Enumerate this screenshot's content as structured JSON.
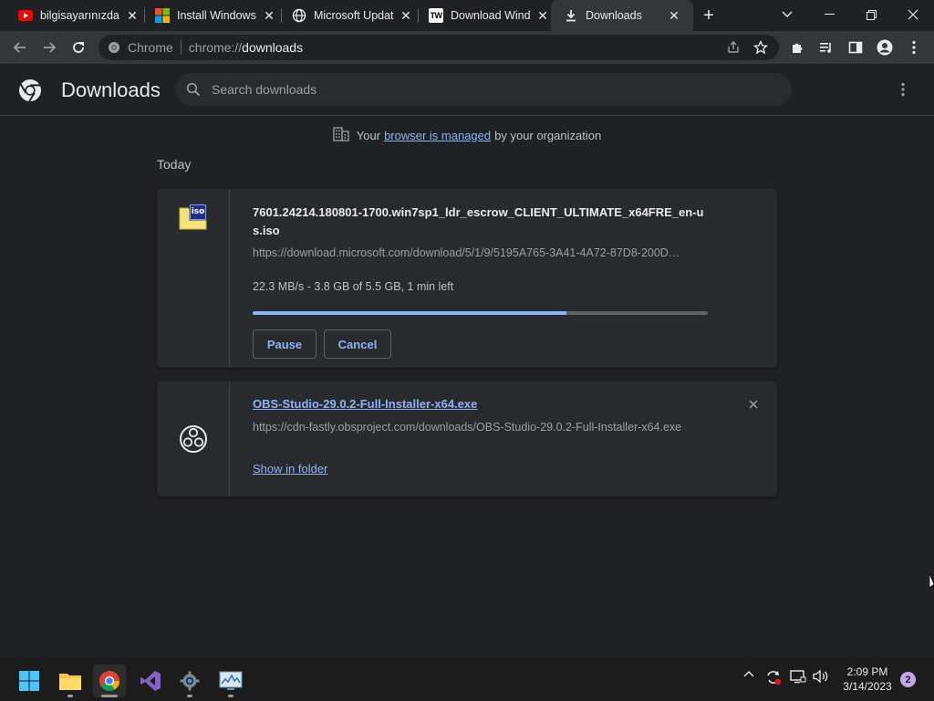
{
  "tabs": [
    {
      "title": "bilgisayarınızda",
      "icon": "youtube-icon"
    },
    {
      "title": "Install Windows",
      "icon": "microsoft-icon"
    },
    {
      "title": "Microsoft Updat",
      "icon": "globe-icon"
    },
    {
      "title": "Download Wind",
      "icon": "tw-icon"
    },
    {
      "title": "Downloads",
      "icon": "download-icon",
      "active": true
    }
  ],
  "tw_label": "TW",
  "omnibox": {
    "site_label": "Chrome",
    "url_scheme": "chrome://",
    "url_path": "downloads"
  },
  "downloads_page": {
    "title": "Downloads",
    "search_placeholder": "Search downloads",
    "managed": {
      "prefix": "Your",
      "link": "browser is managed",
      "suffix": "by your organization"
    },
    "section_label": "Today",
    "items": [
      {
        "filename": "7601.24214.180801-1700.win7sp1_ldr_escrow_CLIENT_ULTIMATE_x64FRE_en-us.iso",
        "url": "https://download.microsoft.com/download/5/1/9/5195A765-3A41-4A72-87D8-200D…",
        "status": "22.3 MB/s - 3.8 GB of 5.5 GB, 1 min left",
        "progress": 0.69,
        "icon_label": "iso",
        "pause_label": "Pause",
        "cancel_label": "Cancel"
      },
      {
        "filename": "OBS-Studio-29.0.2-Full-Installer-x64.exe",
        "url": "https://cdn-fastly.obsproject.com/downloads/OBS-Studio-29.0.2-Full-Installer-x64.exe",
        "show_in_folder_label": "Show in folder"
      }
    ]
  },
  "taskbar": {
    "time": "2:09 PM",
    "date": "3/14/2023",
    "notifications": "2"
  },
  "colors": {
    "accent": "#8ab4f8",
    "background": "#202124",
    "card": "#292a2d"
  }
}
